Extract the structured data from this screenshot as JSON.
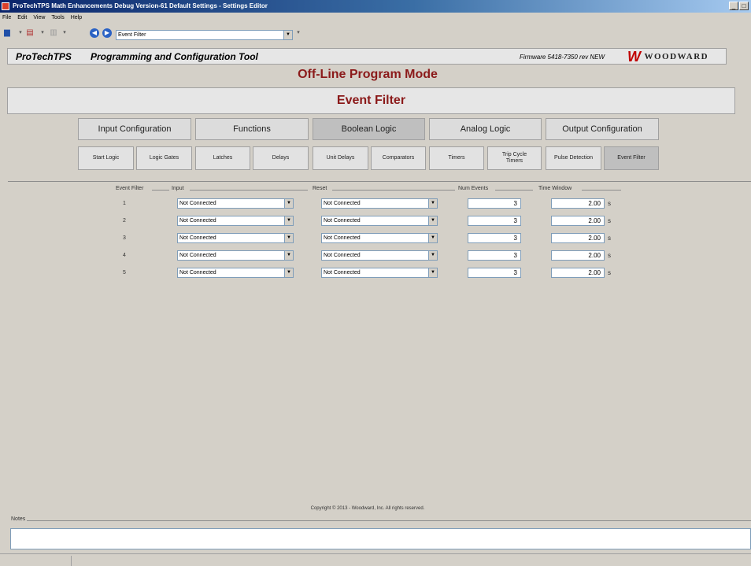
{
  "window": {
    "title": "ProTechTPS Math Enhancements Debug Version-61 Default Settings - Settings Editor",
    "min_glyph": "_",
    "max_glyph": "□"
  },
  "menu": [
    "File",
    "Edit",
    "View",
    "Tools",
    "Help"
  ],
  "toolbar": {
    "nav_value": "Event Filter",
    "icons": [
      "save-icon",
      "open-icon",
      "export-icon",
      "back-icon",
      "forward-icon"
    ]
  },
  "header": {
    "product": "ProTechTPS",
    "tool": "Programming and Configuration Tool",
    "firmware": "Firmware 5418-7350 rev NEW",
    "brand": "WOODWARD"
  },
  "mode": "Off-Line Program Mode",
  "page_title": "Event Filter",
  "main_tabs": [
    {
      "label": "Input Configuration"
    },
    {
      "label": "Functions"
    },
    {
      "label": "Boolean Logic"
    },
    {
      "label": "Analog Logic"
    },
    {
      "label": "Output Configuration"
    }
  ],
  "sub_tabs": [
    {
      "label": "Start Logic"
    },
    {
      "label": "Logic Gates"
    },
    {
      "label": "Latches"
    },
    {
      "label": "Delays"
    },
    {
      "label": "Unit Delays"
    },
    {
      "label": "Comparators"
    },
    {
      "label": "Timers"
    },
    {
      "label": "Trip Cycle Timers"
    },
    {
      "label": "Pulse Detection"
    },
    {
      "label": "Event Filter"
    }
  ],
  "grid": {
    "headers": {
      "event_filter": "Event Filter",
      "input": "Input",
      "reset": "Reset",
      "num_events": "Num Events",
      "time_window": "Time Window"
    },
    "rows": [
      {
        "num": "1",
        "input": "Not Connected",
        "reset": "Not Connected",
        "num_events": "3",
        "time_window": "2.00",
        "unit": "s"
      },
      {
        "num": "2",
        "input": "Not Connected",
        "reset": "Not Connected",
        "num_events": "3",
        "time_window": "2.00",
        "unit": "s"
      },
      {
        "num": "3",
        "input": "Not Connected",
        "reset": "Not Connected",
        "num_events": "3",
        "time_window": "2.00",
        "unit": "s"
      },
      {
        "num": "4",
        "input": "Not Connected",
        "reset": "Not Connected",
        "num_events": "3",
        "time_window": "2.00",
        "unit": "s"
      },
      {
        "num": "5",
        "input": "Not Connected",
        "reset": "Not Connected",
        "num_events": "3",
        "time_window": "2.00",
        "unit": "s"
      }
    ]
  },
  "copyright": "Copyright © 2013 - Woodward, Inc. All rights reserved.",
  "notes_label": "Notes"
}
